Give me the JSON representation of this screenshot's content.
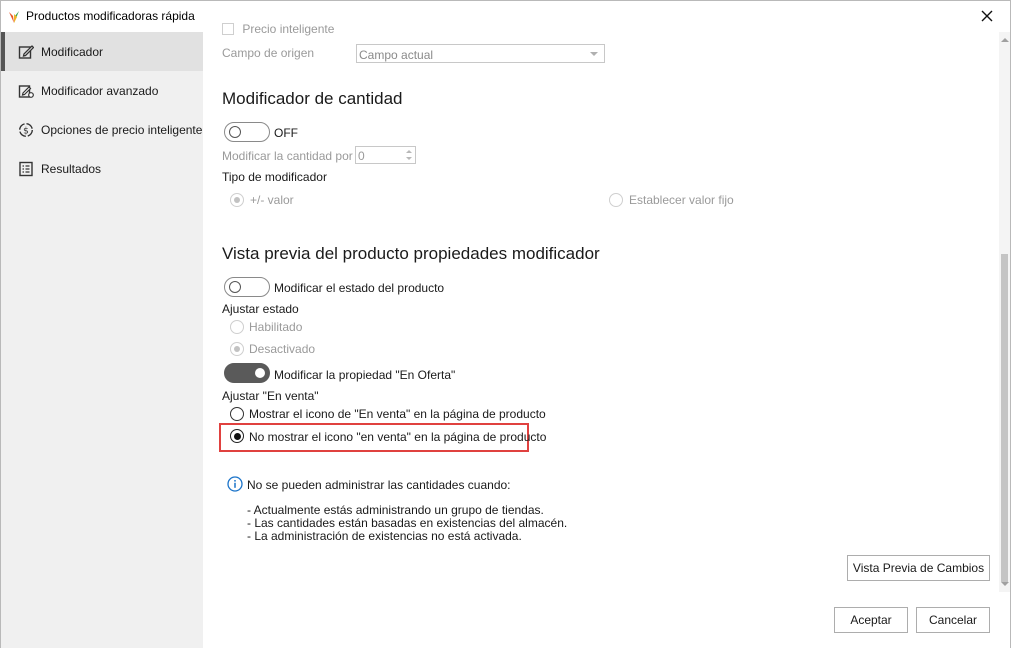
{
  "window": {
    "title": "Productos modificadoras rápida"
  },
  "sidebar": {
    "items": [
      {
        "label": "Modificador",
        "icon": "edit-icon",
        "active": true
      },
      {
        "label": "Modificador avanzado",
        "icon": "advanced-edit-icon",
        "active": false
      },
      {
        "label": "Opciones de precio inteligente",
        "icon": "smart-price-icon",
        "active": false
      },
      {
        "label": "Resultados",
        "icon": "results-icon",
        "active": false
      }
    ]
  },
  "main": {
    "origin": {
      "label": "Campo de origen",
      "value": "Campo actual",
      "partial_label": "Precio inteligente"
    },
    "quantity": {
      "title": "Modificador de cantidad",
      "toggle_state": "OFF",
      "modify_label": "Modificar la cantidad por",
      "modify_value": "0",
      "type_label": "Tipo de modificador",
      "option_plus_minus": "+/- valor",
      "option_fixed": "Establecer valor fijo"
    },
    "preview": {
      "title": "Vista previa del producto propiedades modificador",
      "status_toggle_label": "Modificar el estado del producto",
      "adjust_status_label": "Ajustar estado",
      "status_enabled": "Habilitado",
      "status_disabled": "Desactivado",
      "offer_toggle_label": "Modificar la propiedad \"En Oferta\"",
      "adjust_sale_label": "Ajustar \"En venta\"",
      "sale_show": "Mostrar el icono de \"En venta\" en la página de producto",
      "sale_hide": "No mostrar el icono \"en venta\" en la página de producto"
    },
    "info": {
      "heading": "No se pueden administrar las cantidades cuando:",
      "lines": [
        "- Actualmente estás administrando un grupo de tiendas.",
        "- Las cantidades están basadas en existencias del almacén.",
        "- La administración de existencias no está activada."
      ]
    },
    "buttons": {
      "preview_changes": "Vista Previa de Cambios",
      "accept": "Aceptar",
      "cancel": "Cancelar"
    }
  },
  "colors": {
    "highlight": "#e0413f",
    "info_blue": "#1a73c9",
    "sidebar_bg": "#f0f0f0"
  }
}
